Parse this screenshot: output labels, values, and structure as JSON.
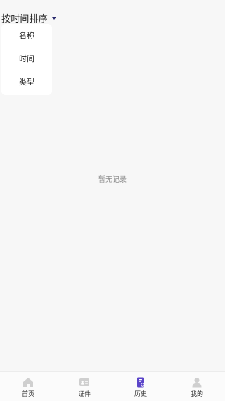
{
  "sort": {
    "label": "按时间排序",
    "options": [
      {
        "label": "名称"
      },
      {
        "label": "时间"
      },
      {
        "label": "类型"
      }
    ]
  },
  "empty": {
    "message": "暂无记录"
  },
  "tabbar": {
    "tabs": [
      {
        "label": "首页",
        "icon": "home-icon"
      },
      {
        "label": "证件",
        "icon": "id-card-icon"
      },
      {
        "label": "历史",
        "icon": "history-document-icon",
        "active": true
      },
      {
        "label": "我的",
        "icon": "user-icon"
      }
    ]
  },
  "colors": {
    "accent": "#5b45c9",
    "inactive_icon": "#cfcfcf",
    "background": "#f7f7f7"
  }
}
